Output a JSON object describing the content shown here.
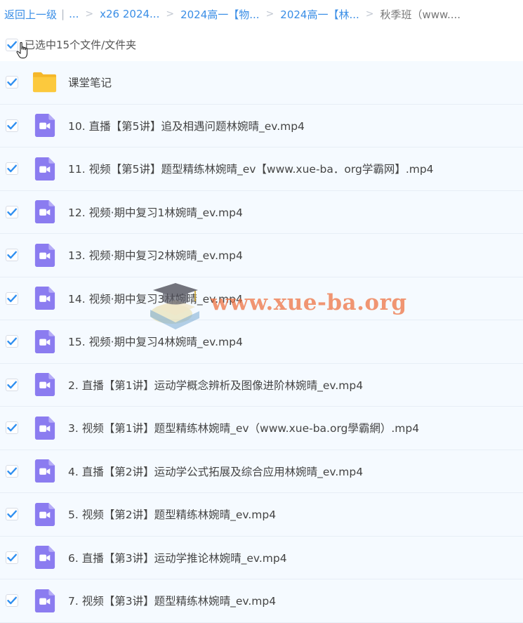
{
  "breadcrumb": {
    "back": "返回上一级",
    "divider": "|",
    "ellipsis": "...",
    "items": [
      "x26 2024...",
      "2024高一【物...",
      "2024高一【林...",
      "秋季班（www...."
    ],
    "separator": ">"
  },
  "selection": {
    "text": "已选中15个文件/文件夹"
  },
  "files": [
    {
      "name": "课堂笔记",
      "type": "folder"
    },
    {
      "name": "10. 直播【第5讲】追及相遇问题林婉晴_ev.mp4",
      "type": "video"
    },
    {
      "name": "11. 视频【第5讲】题型精练林婉晴_ev【www.xue-ba．org学霸网】.mp4",
      "type": "video"
    },
    {
      "name": "12. 视频·期中复习1林婉晴_ev.mp4",
      "type": "video"
    },
    {
      "name": "13. 视频·期中复习2林婉晴_ev.mp4",
      "type": "video"
    },
    {
      "name": "14. 视频·期中复习3林婉晴_ev.mp4",
      "type": "video"
    },
    {
      "name": "15. 视频·期中复习4林婉晴_ev.mp4",
      "type": "video"
    },
    {
      "name": "2. 直播【第1讲】运动学概念辨析及图像进阶林婉晴_ev.mp4",
      "type": "video"
    },
    {
      "name": "3. 视频【第1讲】题型精练林婉晴_ev（www.xue-ba.org學霸網）.mp4",
      "type": "video"
    },
    {
      "name": "4. 直播【第2讲】运动学公式拓展及综合应用林婉晴_ev.mp4",
      "type": "video"
    },
    {
      "name": "5. 视频【第2讲】题型精练林婉晴_ev.mp4",
      "type": "video"
    },
    {
      "name": "6. 直播【第3讲】运动学推论林婉晴_ev.mp4",
      "type": "video"
    },
    {
      "name": "7. 视频【第3讲】题型精练林婉晴_ev.mp4",
      "type": "video"
    }
  ],
  "watermark": {
    "text": "www.xue-ba.org"
  },
  "colors": {
    "accent": "#3a8ee6",
    "check": "#2f8ff0",
    "video_icon": "#8b7cf0",
    "folder": "#fbc636",
    "row_bg": "#f5faff"
  },
  "icons": {
    "checkbox": "check-icon",
    "cursor": "hand-pointer-icon",
    "folder": "folder-icon",
    "video": "video-file-icon",
    "watermark": "graduation-cap-icon"
  }
}
